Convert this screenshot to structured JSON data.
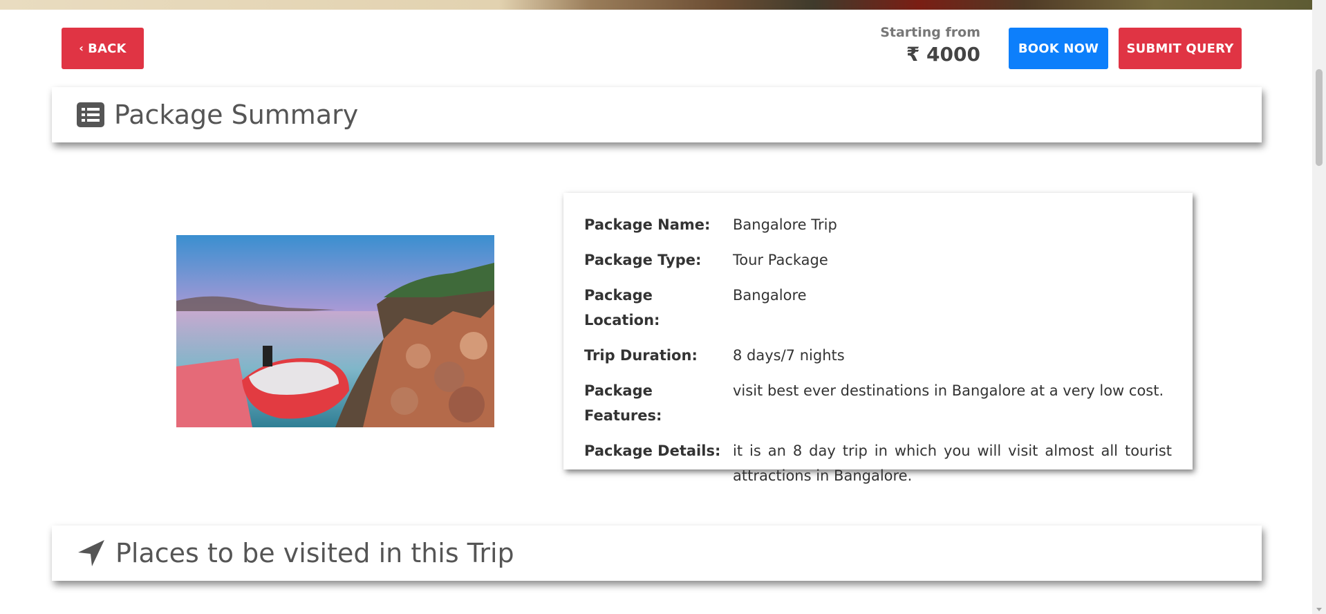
{
  "actions": {
    "back_label": "BACK",
    "book_label": "BOOK NOW",
    "query_label": "SUBMIT QUERY"
  },
  "price": {
    "label": "Starting from",
    "value": "₹ 4000"
  },
  "summary_section": {
    "title": "Package Summary",
    "icon": "list-icon"
  },
  "package": {
    "image_icon": "boat-lake-photo",
    "details": [
      {
        "label": "Package Name:",
        "value": "Bangalore Trip"
      },
      {
        "label": "Package Type:",
        "value": "Tour Package"
      },
      {
        "label": "Package Location:",
        "value": "Bangalore"
      },
      {
        "label": "Trip Duration:",
        "value": "8 days/7 nights"
      },
      {
        "label": "Package Features:",
        "value": "visit best ever destinations in Bangalore at a very low cost."
      },
      {
        "label": "Package Details:",
        "value": "it is an 8 day trip in which you will visit almost all tourist attractions in Bangalore."
      }
    ]
  },
  "places_section": {
    "title": "Places to be visited in this Trip",
    "icon": "location-arrow-icon"
  },
  "colors": {
    "primary": "#0d7ffb",
    "danger": "#e03444",
    "heading": "#555555"
  }
}
